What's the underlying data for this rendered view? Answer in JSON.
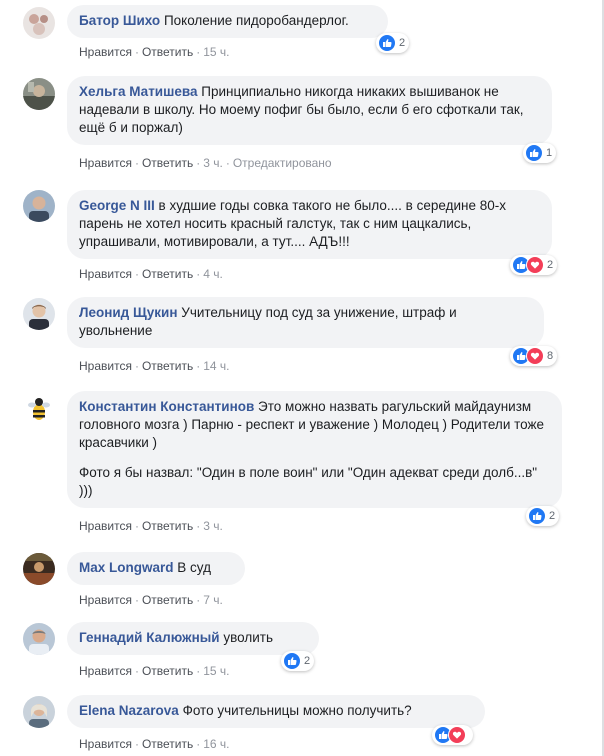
{
  "colors": {
    "author": "#385898",
    "bubble": "#f2f3f5",
    "meta": "#90949c",
    "like": "#2078f4",
    "love": "#f33e58"
  },
  "comments": [
    {
      "author": "Батор Шихо",
      "text": "Поколение пидоробандерлог.",
      "actions": {
        "like": "Нравится",
        "reply": "Ответить",
        "time": "15 ч."
      },
      "reactions": {
        "types": [
          "like"
        ],
        "count": "2"
      }
    },
    {
      "author": "Хельга Матишева",
      "text": "Принципиально никогда никаких вышиванок не надевали в школу. Но моему пофиг бы было, если б его сфоткали так, ещё б и поржал)",
      "actions": {
        "like": "Нравится",
        "reply": "Ответить",
        "time": "3 ч.",
        "edited": "Отредактировано"
      },
      "reactions": {
        "types": [
          "like"
        ],
        "count": "1"
      }
    },
    {
      "author": "George N III",
      "text": "в худшие годы совка такого не было.... в середине 80-х парень не хотел носить красный галстук, так с ним цацкались, упрашивали, мотивировали, а тут.... АДЪ!!!",
      "actions": {
        "like": "Нравится",
        "reply": "Ответить",
        "time": "4 ч."
      },
      "reactions": {
        "types": [
          "like",
          "love"
        ],
        "count": "2"
      }
    },
    {
      "author": "Леонид Щукин",
      "text": "Учительницу под суд за унижение, штраф и увольнение",
      "actions": {
        "like": "Нравится",
        "reply": "Ответить",
        "time": "14 ч."
      },
      "reactions": {
        "types": [
          "like",
          "love"
        ],
        "count": "8"
      }
    },
    {
      "author": "Константин Константинов",
      "text": "Это можно назвать рагульский майдаунизм головного мозга ) Парню - респект и уважение ) Молодец ) Родители тоже красавчики )",
      "text2": "Фото я бы назвал: \"Один в поле воин\" или \"Один адекват среди долб...в\" )))",
      "actions": {
        "like": "Нравится",
        "reply": "Ответить",
        "time": "3 ч."
      },
      "reactions": {
        "types": [
          "like"
        ],
        "count": "2"
      }
    },
    {
      "author": "Max Longward",
      "text": "В суд",
      "actions": {
        "like": "Нравится",
        "reply": "Ответить",
        "time": "7 ч."
      },
      "reactions": null
    },
    {
      "author": "Геннадий Калюжный",
      "text": "уволить",
      "actions": {
        "like": "Нравится",
        "reply": "Ответить",
        "time": "15 ч."
      },
      "reactions": {
        "types": [
          "like"
        ],
        "count": "2"
      }
    },
    {
      "author": "Elena Nazarova",
      "text": "Фото учительницы можно получить?",
      "actions": {
        "like": "Нравится",
        "reply": "Ответить",
        "time": "16 ч."
      },
      "reactions": {
        "types": [
          "like",
          "love"
        ],
        "count": ""
      }
    }
  ]
}
